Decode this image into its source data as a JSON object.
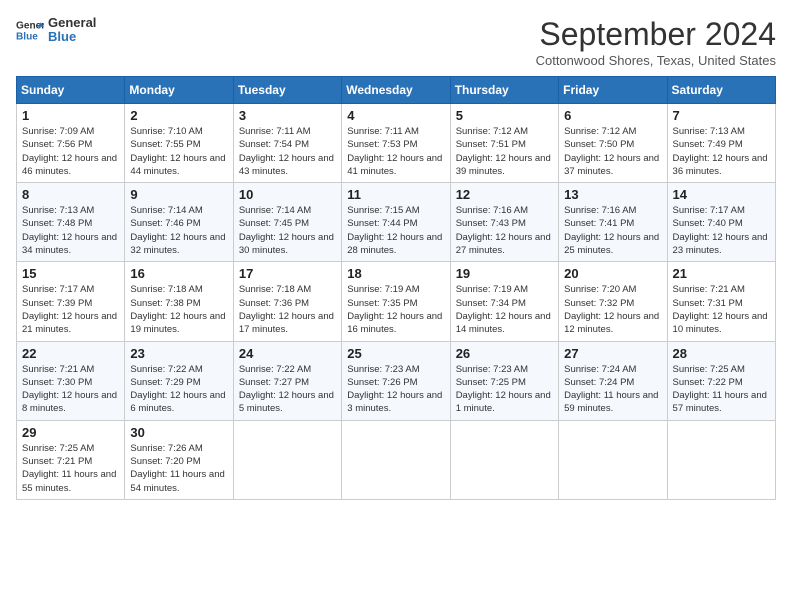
{
  "logo": {
    "text_general": "General",
    "text_blue": "Blue"
  },
  "header": {
    "month": "September 2024",
    "location": "Cottonwood Shores, Texas, United States"
  },
  "weekdays": [
    "Sunday",
    "Monday",
    "Tuesday",
    "Wednesday",
    "Thursday",
    "Friday",
    "Saturday"
  ],
  "weeks": [
    [
      {
        "day": "1",
        "sunrise": "7:09 AM",
        "sunset": "7:56 PM",
        "daylight": "12 hours and 46 minutes."
      },
      {
        "day": "2",
        "sunrise": "7:10 AM",
        "sunset": "7:55 PM",
        "daylight": "12 hours and 44 minutes."
      },
      {
        "day": "3",
        "sunrise": "7:11 AM",
        "sunset": "7:54 PM",
        "daylight": "12 hours and 43 minutes."
      },
      {
        "day": "4",
        "sunrise": "7:11 AM",
        "sunset": "7:53 PM",
        "daylight": "12 hours and 41 minutes."
      },
      {
        "day": "5",
        "sunrise": "7:12 AM",
        "sunset": "7:51 PM",
        "daylight": "12 hours and 39 minutes."
      },
      {
        "day": "6",
        "sunrise": "7:12 AM",
        "sunset": "7:50 PM",
        "daylight": "12 hours and 37 minutes."
      },
      {
        "day": "7",
        "sunrise": "7:13 AM",
        "sunset": "7:49 PM",
        "daylight": "12 hours and 36 minutes."
      }
    ],
    [
      {
        "day": "8",
        "sunrise": "7:13 AM",
        "sunset": "7:48 PM",
        "daylight": "12 hours and 34 minutes."
      },
      {
        "day": "9",
        "sunrise": "7:14 AM",
        "sunset": "7:46 PM",
        "daylight": "12 hours and 32 minutes."
      },
      {
        "day": "10",
        "sunrise": "7:14 AM",
        "sunset": "7:45 PM",
        "daylight": "12 hours and 30 minutes."
      },
      {
        "day": "11",
        "sunrise": "7:15 AM",
        "sunset": "7:44 PM",
        "daylight": "12 hours and 28 minutes."
      },
      {
        "day": "12",
        "sunrise": "7:16 AM",
        "sunset": "7:43 PM",
        "daylight": "12 hours and 27 minutes."
      },
      {
        "day": "13",
        "sunrise": "7:16 AM",
        "sunset": "7:41 PM",
        "daylight": "12 hours and 25 minutes."
      },
      {
        "day": "14",
        "sunrise": "7:17 AM",
        "sunset": "7:40 PM",
        "daylight": "12 hours and 23 minutes."
      }
    ],
    [
      {
        "day": "15",
        "sunrise": "7:17 AM",
        "sunset": "7:39 PM",
        "daylight": "12 hours and 21 minutes."
      },
      {
        "day": "16",
        "sunrise": "7:18 AM",
        "sunset": "7:38 PM",
        "daylight": "12 hours and 19 minutes."
      },
      {
        "day": "17",
        "sunrise": "7:18 AM",
        "sunset": "7:36 PM",
        "daylight": "12 hours and 17 minutes."
      },
      {
        "day": "18",
        "sunrise": "7:19 AM",
        "sunset": "7:35 PM",
        "daylight": "12 hours and 16 minutes."
      },
      {
        "day": "19",
        "sunrise": "7:19 AM",
        "sunset": "7:34 PM",
        "daylight": "12 hours and 14 minutes."
      },
      {
        "day": "20",
        "sunrise": "7:20 AM",
        "sunset": "7:32 PM",
        "daylight": "12 hours and 12 minutes."
      },
      {
        "day": "21",
        "sunrise": "7:21 AM",
        "sunset": "7:31 PM",
        "daylight": "12 hours and 10 minutes."
      }
    ],
    [
      {
        "day": "22",
        "sunrise": "7:21 AM",
        "sunset": "7:30 PM",
        "daylight": "12 hours and 8 minutes."
      },
      {
        "day": "23",
        "sunrise": "7:22 AM",
        "sunset": "7:29 PM",
        "daylight": "12 hours and 6 minutes."
      },
      {
        "day": "24",
        "sunrise": "7:22 AM",
        "sunset": "7:27 PM",
        "daylight": "12 hours and 5 minutes."
      },
      {
        "day": "25",
        "sunrise": "7:23 AM",
        "sunset": "7:26 PM",
        "daylight": "12 hours and 3 minutes."
      },
      {
        "day": "26",
        "sunrise": "7:23 AM",
        "sunset": "7:25 PM",
        "daylight": "12 hours and 1 minute."
      },
      {
        "day": "27",
        "sunrise": "7:24 AM",
        "sunset": "7:24 PM",
        "daylight": "11 hours and 59 minutes."
      },
      {
        "day": "28",
        "sunrise": "7:25 AM",
        "sunset": "7:22 PM",
        "daylight": "11 hours and 57 minutes."
      }
    ],
    [
      {
        "day": "29",
        "sunrise": "7:25 AM",
        "sunset": "7:21 PM",
        "daylight": "11 hours and 55 minutes."
      },
      {
        "day": "30",
        "sunrise": "7:26 AM",
        "sunset": "7:20 PM",
        "daylight": "11 hours and 54 minutes."
      },
      null,
      null,
      null,
      null,
      null
    ]
  ]
}
